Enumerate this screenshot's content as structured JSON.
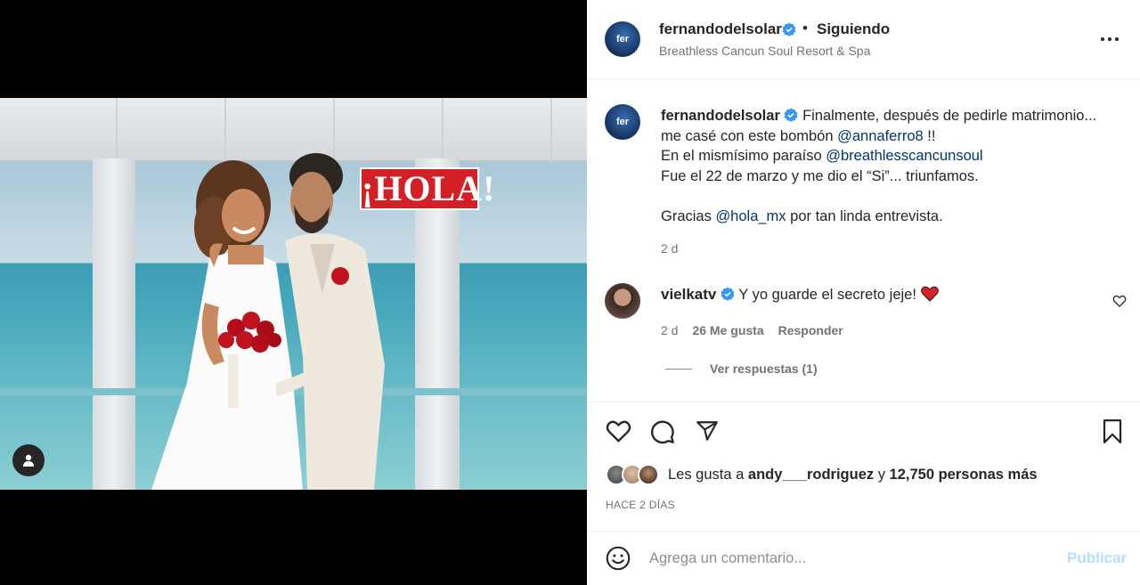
{
  "post": {
    "author": "fernandodelsolar",
    "follow_status": "Siguiendo",
    "separator": "•",
    "location": "Breathless Cancun Soul Resort & Spa",
    "avatar_text": "fer",
    "overlay_logo_text": "¡HOLA!",
    "caption": {
      "line1": "Finalmente, después de pedirle matrimonio...",
      "line2_pre": "me casé con este bombón ",
      "line2_mention": "@annaferro8",
      "line2_post": " !!",
      "line3_pre": "En el mismísimo paraíso ",
      "line3_mention": "@breathlesscancunsoul",
      "line4": "Fue el 22 de marzo y me dio el “Si”... triunfamos.",
      "line5_pre": "Gracias ",
      "line5_mention": "@hola_mx",
      "line5_post": " por tan linda entrevista.",
      "time": "2 d"
    },
    "comment": {
      "author": "vielkatv",
      "text": "Y yo guarde el secreto jeje!",
      "time": "2 d",
      "likes": "26 Me gusta",
      "reply_label": "Responder",
      "view_replies": "Ver respuestas (1)"
    },
    "likes": {
      "prefix": "Les gusta a ",
      "user": "andy___rodriguez",
      "mid": " y ",
      "count": "12,750 personas más"
    },
    "posted_ago": "HACE 2 DÍAS",
    "add_comment_placeholder": "Agrega un comentario...",
    "publish_label": "Publicar"
  },
  "colors": {
    "verified": "#3897f0",
    "mention": "#00376b",
    "publish_disabled": "#b2dffc",
    "hola_red": "#d32027"
  },
  "icons": [
    "user-tag-icon",
    "more-options-icon",
    "verified-icon",
    "heart-icon",
    "comment-icon",
    "share-icon",
    "save-icon",
    "emoji-icon",
    "red-heart-emoji"
  ]
}
